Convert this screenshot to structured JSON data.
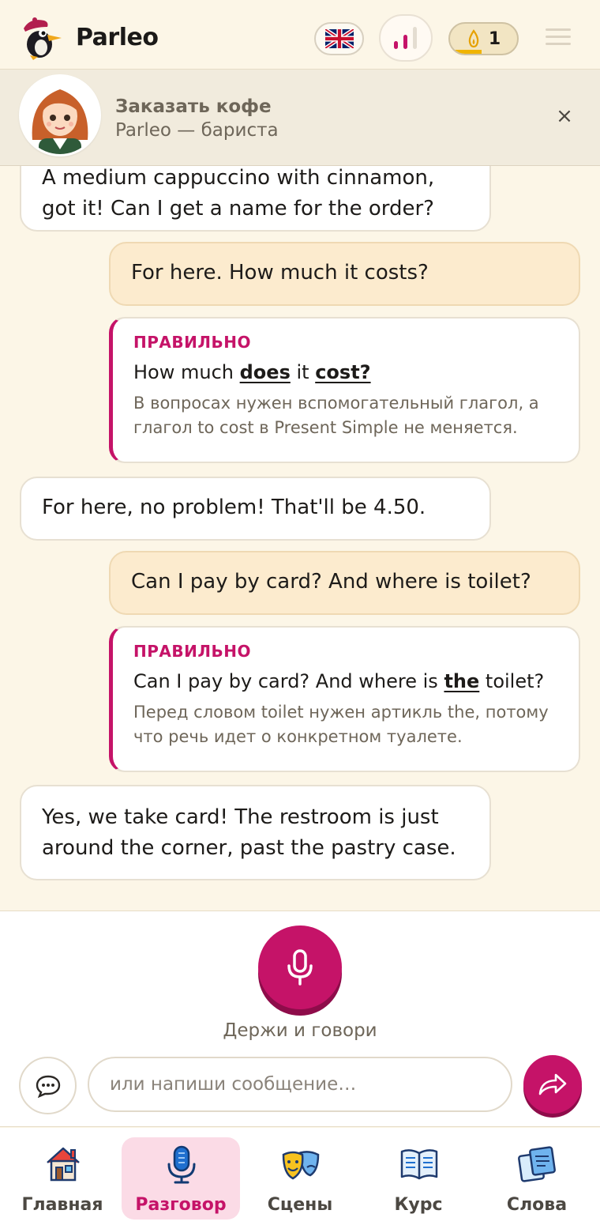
{
  "header": {
    "brand": "Parleo",
    "language_icon": "uk-flag-icon",
    "level_icon": "bar-chart-icon",
    "streak_icon": "flame-icon",
    "streak_count": "1",
    "menu_icon": "hamburger-menu-icon"
  },
  "scenario": {
    "title": "Заказать кофе",
    "subtitle": "Parleo — бариста",
    "close_label": "×"
  },
  "messages": [
    {
      "role": "bot",
      "text": "A medium cappuccino with cinnamon, got it! Can I get a name for the order?"
    },
    {
      "role": "user",
      "text": "For here. How much it costs?"
    },
    {
      "role": "correction",
      "tag": "ПРАВИЛЬНО",
      "parts": [
        "How much ",
        "does",
        " it ",
        "cost?"
      ],
      "explanation": "В вопросах нужен вспомогательный глагол, а глагол to cost в Present Simple не меняется."
    },
    {
      "role": "bot",
      "text": "For here, no problem! That'll be 4.50."
    },
    {
      "role": "user",
      "text": "Can I pay by card? And where is toilet?"
    },
    {
      "role": "correction",
      "tag": "ПРАВИЛЬНО",
      "parts": [
        "Can I pay by card? And where is ",
        "the",
        " toilet?"
      ],
      "explanation": "Перед словом toilet нужен артикль the, потому что речь идет о конкретном туалете."
    },
    {
      "role": "bot",
      "text": "Yes, we take card! The restroom is just around the corner, past the pastry case."
    }
  ],
  "voice": {
    "mic_icon": "microphone-icon",
    "hold_label": "Держи и говори",
    "input_placeholder": "или напиши сообщение…",
    "chat_icon": "chat-bubble-icon",
    "send_icon": "send-arrow-icon"
  },
  "nav": {
    "items": [
      {
        "label": "Главная",
        "icon": "house-icon",
        "active": false
      },
      {
        "label": "Разговор",
        "icon": "microphone-icon",
        "active": true
      },
      {
        "label": "Сцены",
        "icon": "theater-masks-icon",
        "active": false
      },
      {
        "label": "Курс",
        "icon": "open-book-icon",
        "active": false
      },
      {
        "label": "Слова",
        "icon": "word-cards-icon",
        "active": false
      }
    ]
  },
  "colors": {
    "accent": "#c51368",
    "background": "#fcf6e7",
    "user_bubble": "#fcebce",
    "nav_active_bg": "#fbdbe6"
  }
}
